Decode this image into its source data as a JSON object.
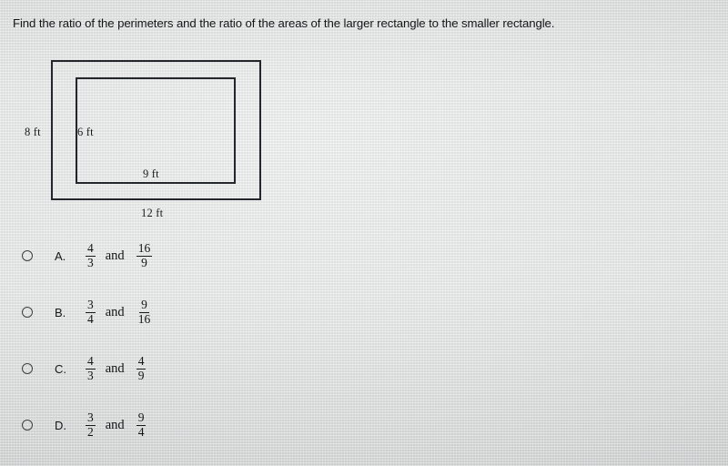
{
  "question": {
    "text": "Find the ratio of the perimeters and the ratio of the areas of the larger rectangle to the smaller rectangle."
  },
  "figure": {
    "outer_rectangle": {
      "height_label": "8 ft",
      "width_label": "12 ft"
    },
    "inner_rectangle": {
      "height_label": "6 ft",
      "width_label": "9 ft"
    }
  },
  "options": [
    {
      "letter": "A.",
      "first": {
        "numerator": "4",
        "denominator": "3"
      },
      "conjunction": "and",
      "second": {
        "numerator": "16",
        "denominator": "9"
      },
      "selected": false
    },
    {
      "letter": "B.",
      "first": {
        "numerator": "3",
        "denominator": "4"
      },
      "conjunction": "and",
      "second": {
        "numerator": "9",
        "denominator": "16"
      },
      "selected": false
    },
    {
      "letter": "C.",
      "first": {
        "numerator": "4",
        "denominator": "3"
      },
      "conjunction": "and",
      "second": {
        "numerator": "4",
        "denominator": "9"
      },
      "selected": false
    },
    {
      "letter": "D.",
      "first": {
        "numerator": "3",
        "denominator": "2"
      },
      "conjunction": "and",
      "second": {
        "numerator": "9",
        "denominator": "4"
      },
      "selected": false
    }
  ],
  "colors": {
    "background": "#e2e3e3",
    "ink": "#17191b",
    "stroke": "#23272b"
  }
}
